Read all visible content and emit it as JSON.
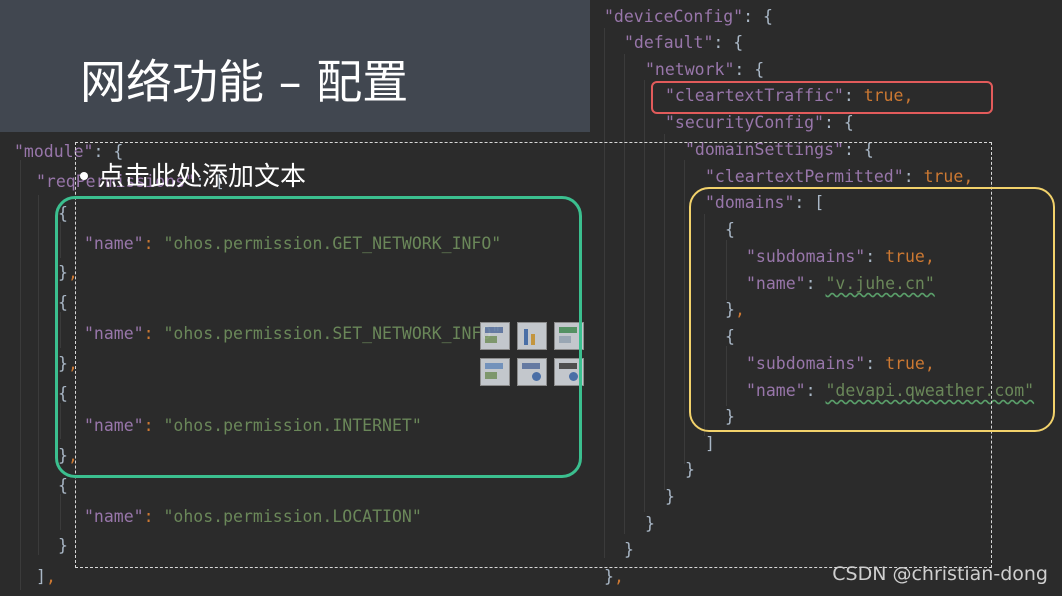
{
  "slide": {
    "title": "网络功能 – 配置",
    "placeholder_text": "点击此处添加文本",
    "watermark": "CSDN @christian-dong"
  },
  "left_code": {
    "module_key": "\"module\"",
    "req_key": "\"reqPermissions\"",
    "name_key": "\"name\"",
    "permissions": [
      "\"ohos.permission.GET_NETWORK_INFO\"",
      "\"ohos.permission.SET_NETWORK_INFO\"",
      "\"ohos.permission.INTERNET\"",
      "\"ohos.permission.LOCATION\""
    ]
  },
  "right_code": {
    "device_config_key": "\"deviceConfig\"",
    "default_key": "\"default\"",
    "network_key": "\"network\"",
    "cleartext_traffic_key": "\"cleartextTraffic\"",
    "security_config_key": "\"securityConfig\"",
    "domain_settings_key": "\"domainSettings\"",
    "cleartext_permitted_key": "\"cleartextPermitted\"",
    "domains_key": "\"domains\"",
    "subdomains_key": "\"subdomains\"",
    "name_key": "\"name\"",
    "true_value": "true",
    "domain_1": "\"v.juhe.cn\"",
    "domain_2": "\"devapi.qweather.com\""
  },
  "colors": {
    "editor_bg": "#2b2b2b",
    "key": "#9876aa",
    "string": "#6a8759",
    "keyword": "#cc7832",
    "highlight_red": "#e25b5b",
    "highlight_green": "#3bbf8f",
    "highlight_yellow": "#f2d26b"
  }
}
